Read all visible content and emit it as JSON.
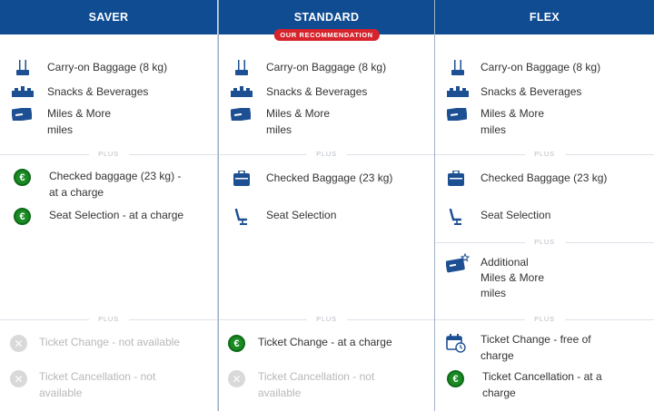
{
  "columns": {
    "saver": {
      "title": "SAVER",
      "carry_on": "Carry-on Baggage (8 kg)",
      "snacks": "Snacks & Beverages",
      "miles_line1": "Miles & More",
      "miles_line2": "miles",
      "plus1": "PLUS",
      "checked_line1": "Checked baggage (23 kg) -",
      "checked_line2": "at a charge",
      "seat": "Seat Selection - at a charge",
      "plus2": "PLUS",
      "change": "Ticket Change - not available",
      "cancel_line1": "Ticket Cancellation - not",
      "cancel_line2": "available"
    },
    "standard": {
      "title": "STANDARD",
      "badge": "OUR RECOMMENDATION",
      "carry_on": "Carry-on Baggage (8 kg)",
      "snacks": "Snacks & Beverages",
      "miles_line1": "Miles & More",
      "miles_line2": "miles",
      "plus1": "PLUS",
      "checked": "Checked Baggage (23 kg)",
      "seat": "Seat Selection",
      "plus2": "PLUS",
      "change": "Ticket Change - at a charge",
      "cancel_line1": "Ticket Cancellation - not",
      "cancel_line2": "available"
    },
    "flex": {
      "title": "FLEX",
      "carry_on": "Carry-on Baggage (8 kg)",
      "snacks": "Snacks & Beverages",
      "miles_line1": "Miles & More",
      "miles_line2": "miles",
      "plus1": "PLUS",
      "checked": "Checked Baggage (23 kg)",
      "seat": "Seat Selection",
      "plus2": "PLUS",
      "additional_line1": "Additional",
      "additional_line2": "Miles & More",
      "additional_line3": "miles",
      "plus3": "PLUS",
      "change_line1": "Ticket Change - free of",
      "change_line2": "charge",
      "cancel_line1": "Ticket Cancellation - at a",
      "cancel_line2": "charge"
    }
  },
  "colors": {
    "header_bg": "#0f4c92",
    "badge_bg": "#d6232c",
    "euro_green": "#1a8a23",
    "icon_blue": "#1d4f93",
    "disabled_gray": "#b8b8b8"
  },
  "icons": {
    "carry_on": "luggage-icon",
    "snacks": "snacks-tray-icon",
    "miles": "miles-card-icon",
    "checked": "suitcase-icon",
    "seat": "seat-icon",
    "charge": "euro-icon",
    "unavailable": "x-circle-icon",
    "change": "calendar-change-icon",
    "additional_miles": "miles-card-plus-icon"
  }
}
